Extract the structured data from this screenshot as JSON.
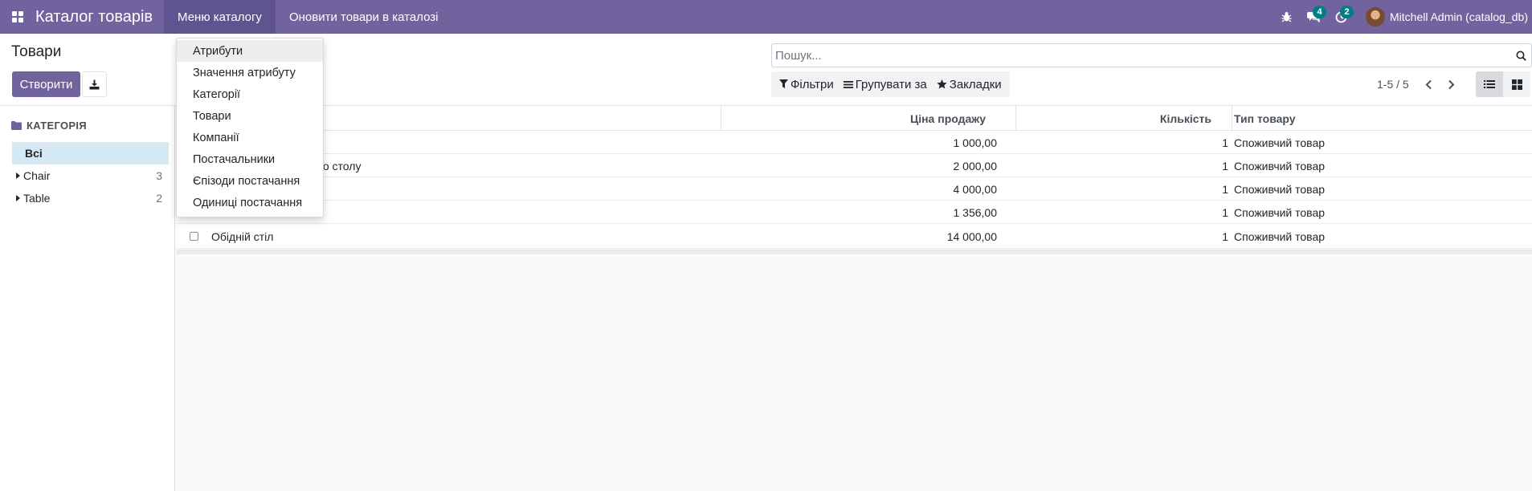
{
  "navbar": {
    "app_title": "Каталог товарів",
    "menus": [
      {
        "label": "Меню каталогу"
      },
      {
        "label": "Оновити товари в каталозі"
      }
    ],
    "messages_count": "4",
    "activities_count": "2",
    "user_name": "Mitchell Admin (catalog_db)"
  },
  "control_panel": {
    "title": "Товари",
    "create_label": "Створити",
    "search_placeholder": "Пошук...",
    "filters_label": "Фільтри",
    "groupby_label": "Групувати за",
    "favorites_label": "Закладки",
    "pager": "1-5 / 5"
  },
  "sidebar": {
    "header": "КАТЕГОРІЯ",
    "items": [
      {
        "label": "Всі",
        "count": ""
      },
      {
        "label": "Chair",
        "count": "3"
      },
      {
        "label": "Table",
        "count": "2"
      }
    ]
  },
  "dropdown": {
    "items": [
      {
        "label": "Атрибути"
      },
      {
        "label": "Значення атрибуту"
      },
      {
        "label": "Категорії"
      },
      {
        "label": "Товари"
      },
      {
        "label": "Компанії"
      },
      {
        "label": "Постачальники"
      },
      {
        "label": "Єпізоди постачання"
      },
      {
        "label": "Одиниці постачання"
      }
    ]
  },
  "table": {
    "columns": [
      "Ціна продажу",
      "Кількість",
      "Тип товару"
    ],
    "rows": [
      {
        "name": "",
        "price": "1 000,00",
        "qty": "1",
        "type": "Споживчий товар"
      },
      {
        "name": "вого столу",
        "price": "2 000,00",
        "qty": "1",
        "type": "Споживчий товар"
      },
      {
        "name": "",
        "price": "4 000,00",
        "qty": "1",
        "type": "Споживчий товар"
      },
      {
        "name": "",
        "price": "1 356,00",
        "qty": "1",
        "type": "Споживчий товар"
      },
      {
        "name": "Обідній стіл",
        "price": "14 000,00",
        "qty": "1",
        "type": "Споживчий товар"
      }
    ]
  },
  "colors": {
    "brand": "#71639e",
    "badge": "#017e84",
    "selected": "#d7e8f5"
  }
}
